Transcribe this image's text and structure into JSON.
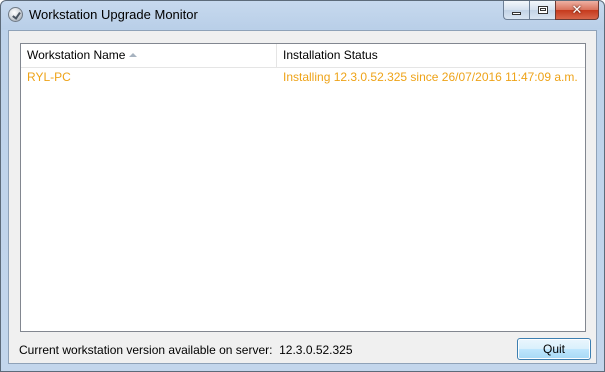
{
  "window": {
    "title": "Workstation Upgrade Monitor",
    "controls": {
      "minimize": "minimize-icon",
      "maximize": "maximize-icon",
      "close": "close-icon"
    }
  },
  "list": {
    "columns": [
      {
        "label": "Workstation Name",
        "sorted": "ascending"
      },
      {
        "label": "Installation Status"
      }
    ],
    "rows": [
      {
        "name": "RYL-PC",
        "status": "Installing 12.3.0.52.325 since 26/07/2016 11:47:09 a.m."
      }
    ]
  },
  "footer": {
    "label": "Current workstation version available on server:",
    "version": "12.3.0.52.325",
    "quit_label": "Quit"
  },
  "colors": {
    "installing_text": "#eea318",
    "button_border": "#3c7fb1"
  }
}
